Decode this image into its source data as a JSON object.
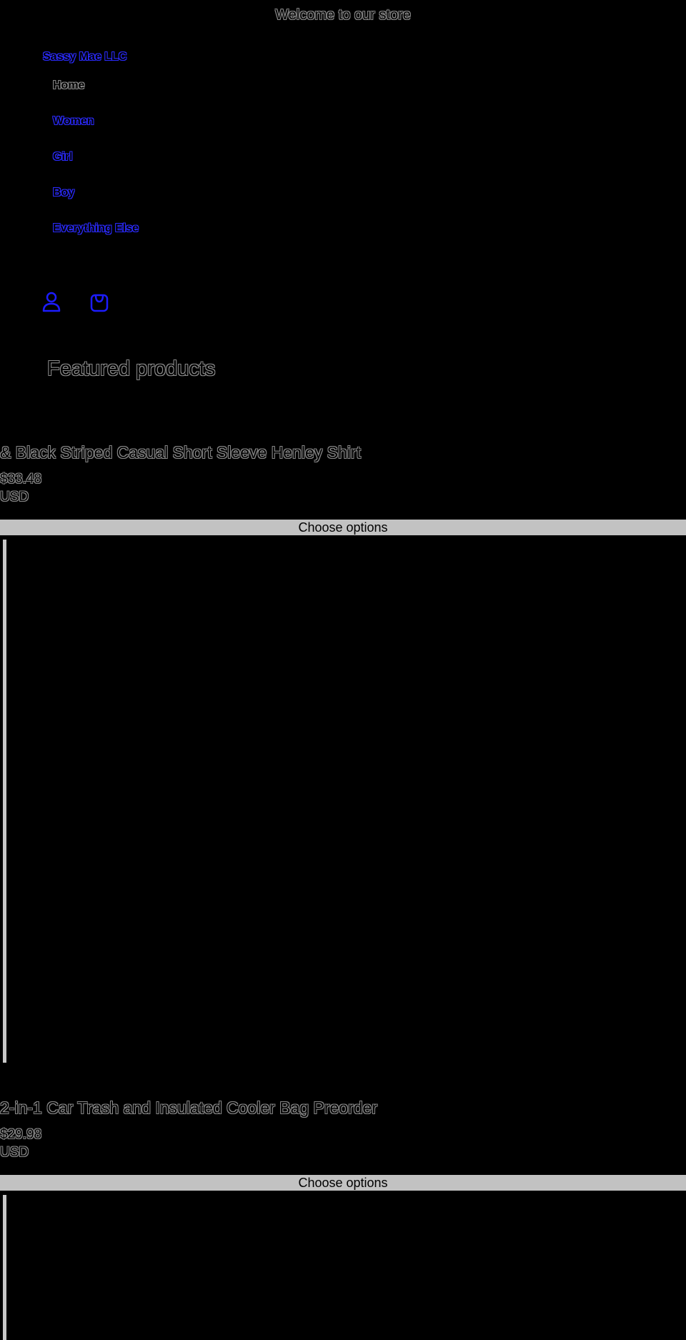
{
  "announcement": "Welcome to our store",
  "header": {
    "store_name": "Sassy Mae LLC",
    "nav": [
      "Home",
      "Women",
      "Girl",
      "Boy",
      "Everything Else"
    ],
    "account_icon": "account-icon",
    "cart_icon": "cart-icon"
  },
  "featured": {
    "title": "Featured products",
    "products": [
      {
        "title": "& Black Striped Casual Short Sleeve Henley Shirt",
        "price": "$33.48",
        "currency": "USD",
        "button": "Choose options"
      },
      {
        "title": "2-in-1 Car Trash and Insulated Cooler Bag Preorder",
        "price": "$29.98",
        "currency": "USD",
        "button": "Choose options"
      }
    ]
  },
  "colors": {
    "background": "#000000",
    "link": "#2b2bff",
    "button": "#c2c2c2"
  }
}
